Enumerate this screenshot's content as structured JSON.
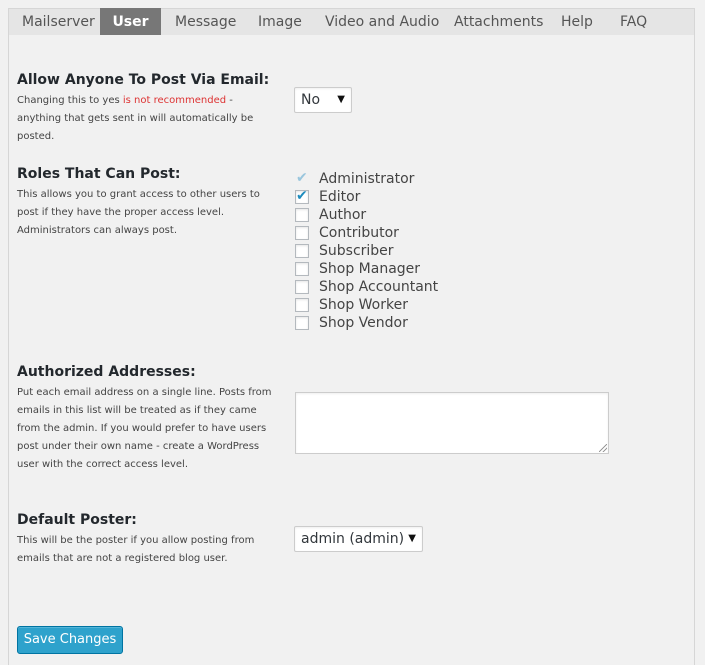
{
  "tabs": [
    {
      "label": "Mailserver"
    },
    {
      "label": "User"
    },
    {
      "label": "Message"
    },
    {
      "label": "Image"
    },
    {
      "label": "Video and Audio"
    },
    {
      "label": "Attachments"
    },
    {
      "label": "Help"
    },
    {
      "label": "FAQ"
    }
  ],
  "active_tab": "User",
  "allow_anyone": {
    "label": "Allow Anyone To Post Via Email:",
    "desc_before": "Changing this to yes ",
    "desc_warn": "is not recommended",
    "desc_after": " - anything that gets sent in will automatically be posted.",
    "value": "No"
  },
  "roles": {
    "label": "Roles That Can Post:",
    "desc": "This allows you to grant access to other users to post if they have the proper access level. Administrators can always post.",
    "items": [
      {
        "name": "Administrator",
        "checked": true,
        "disabled": true
      },
      {
        "name": "Editor",
        "checked": true,
        "disabled": false
      },
      {
        "name": "Author",
        "checked": false,
        "disabled": false
      },
      {
        "name": "Contributor",
        "checked": false,
        "disabled": false
      },
      {
        "name": "Subscriber",
        "checked": false,
        "disabled": false
      },
      {
        "name": "Shop Manager",
        "checked": false,
        "disabled": false
      },
      {
        "name": "Shop Accountant",
        "checked": false,
        "disabled": false
      },
      {
        "name": "Shop Worker",
        "checked": false,
        "disabled": false
      },
      {
        "name": "Shop Vendor",
        "checked": false,
        "disabled": false
      }
    ]
  },
  "authorized": {
    "label": "Authorized Addresses:",
    "desc": "Put each email address on a single line. Posts from emails in this list will be treated as if they came from the admin. If you would prefer to have users post under their own name - create a WordPress user with the correct access level.",
    "value": ""
  },
  "default_poster": {
    "label": "Default Poster:",
    "desc": "This will be the poster if you allow posting from emails that are not a registered blog user.",
    "value": "admin (admin)"
  },
  "save_label": "Save Changes",
  "colors": {
    "accent": "#2ea2cc",
    "warning": "#dd3333",
    "active_tab": "#777777"
  }
}
